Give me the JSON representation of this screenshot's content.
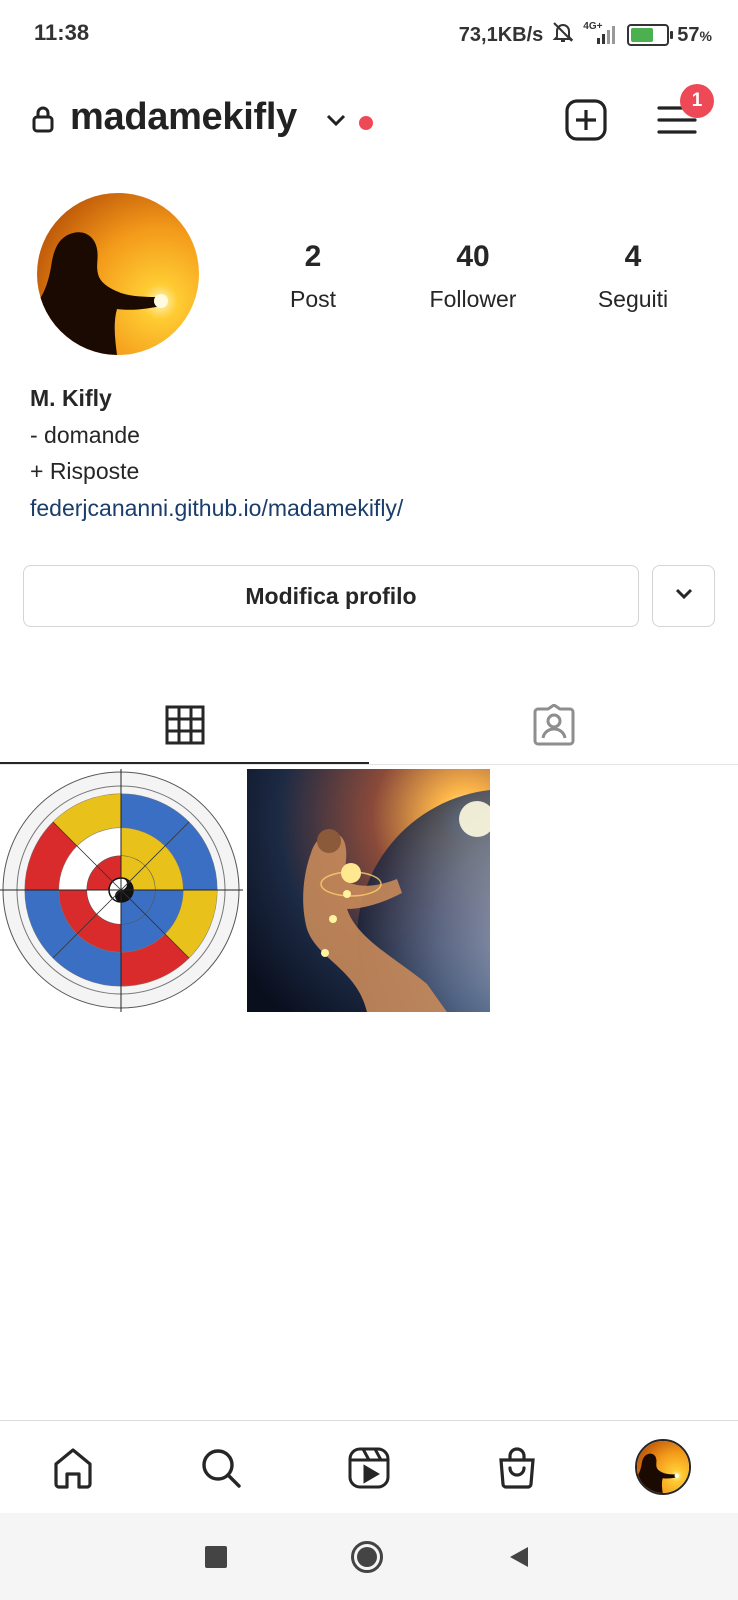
{
  "status_bar": {
    "time": "11:38",
    "network_speed": "73,1KB/s",
    "network_type": "4G+",
    "battery": "57",
    "battery_unit": "%",
    "icons": [
      "bell-muted-icon",
      "signal-icon",
      "battery-charging-icon"
    ]
  },
  "header": {
    "username": "madamekifly",
    "notification_count": "1",
    "icons": [
      "lock-icon",
      "chevron-down-icon",
      "add-post-icon",
      "menu-icon"
    ]
  },
  "profile": {
    "stats": [
      {
        "value": "2",
        "label": "Post"
      },
      {
        "value": "40",
        "label": "Follower"
      },
      {
        "value": "4",
        "label": "Seguiti"
      }
    ],
    "name": "M. Kifly",
    "bio_lines": [
      "- domande",
      "+ Risposte"
    ],
    "link": "federjcananni.github.io/madamekifly/"
  },
  "actions": {
    "edit_profile": "Modifica profilo"
  },
  "tabs": [
    "grid-tab",
    "tagged-tab"
  ],
  "colors": {
    "accent_red": "#ed4956",
    "link": "#1a3d6b",
    "text": "#262626"
  },
  "bottom_nav": [
    "home-icon",
    "search-icon",
    "reels-icon",
    "shop-icon",
    "profile-avatar"
  ]
}
